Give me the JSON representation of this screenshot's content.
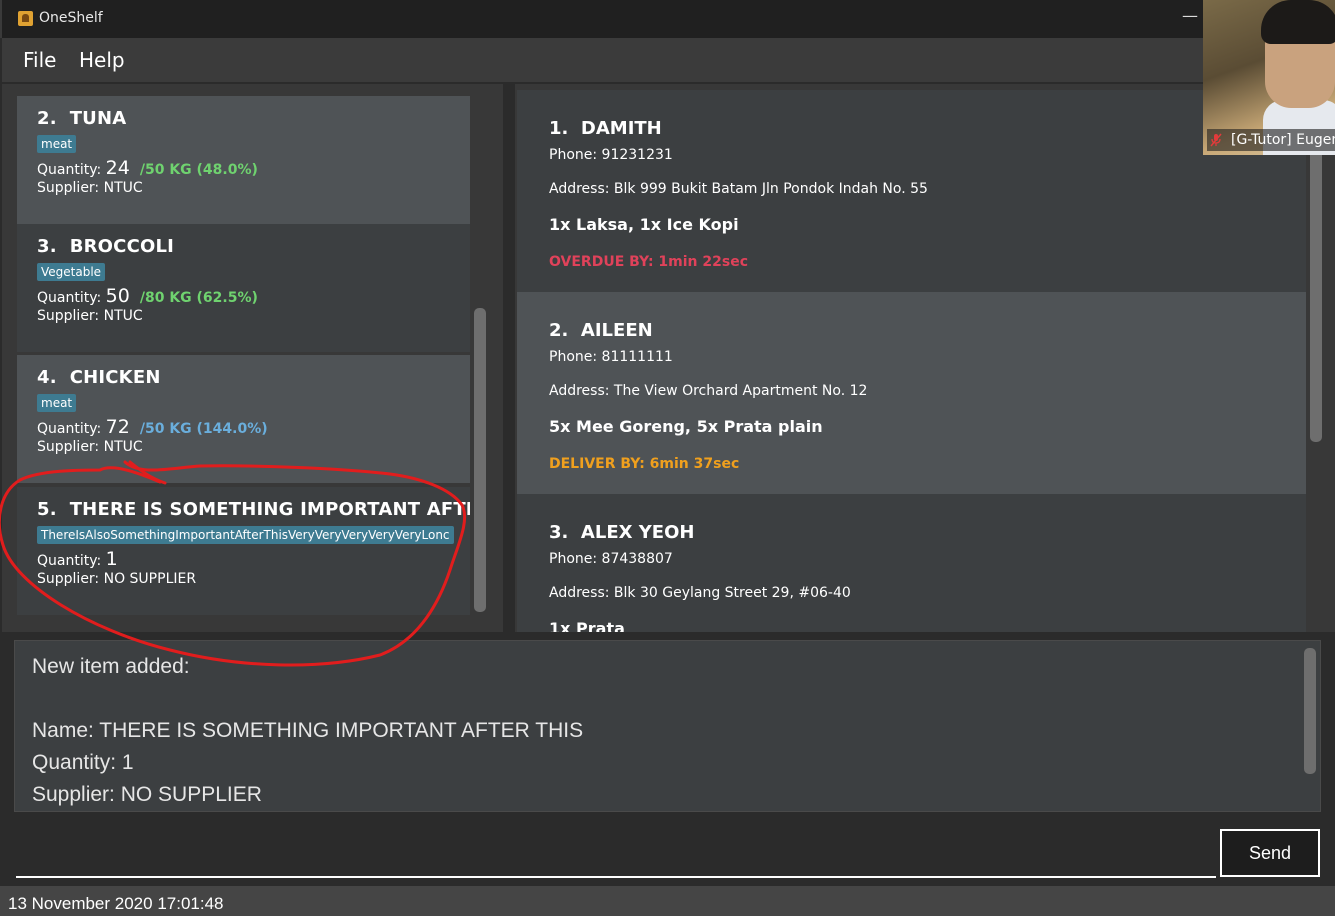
{
  "window": {
    "title": "OneShelf",
    "minimize_glyph": "—"
  },
  "menu": {
    "items": [
      {
        "label": "File"
      },
      {
        "label": "Help"
      }
    ]
  },
  "inventory": {
    "items": [
      {
        "index": "2.",
        "name": "TUNA",
        "tag": "meat",
        "quantity_label": "Quantity:",
        "quantity": "24",
        "max_label": "/50 KG (48.0%)",
        "max_color": "#6fd26f",
        "supplier": "Supplier: NTUC"
      },
      {
        "index": "3.",
        "name": "BROCCOLI",
        "tag": "Vegetable",
        "quantity_label": "Quantity:",
        "quantity": "50",
        "max_label": "/80 KG (62.5%)",
        "max_color": "#6fd26f",
        "supplier": "Supplier: NTUC"
      },
      {
        "index": "4.",
        "name": "CHICKEN",
        "tag": "meat",
        "quantity_label": "Quantity:",
        "quantity": "72",
        "max_label": "/50 KG (144.0%)",
        "max_color": "#6aaedc",
        "supplier": "Supplier: NTUC"
      },
      {
        "index": "5.",
        "name": "THERE IS SOMETHING IMPORTANT AFTER TI",
        "tag": "ThereIsAlsoSomethingImportantAfterThisVeryVeryVeryVeryVeryLonc",
        "quantity_label": "Quantity:",
        "quantity": "1",
        "max_label": "",
        "max_color": "#6fd26f",
        "supplier": "Supplier: NO SUPPLIER"
      }
    ]
  },
  "orders": {
    "items": [
      {
        "index": "1.",
        "name": "DAMITH",
        "phone": "Phone: 91231231",
        "address": "Address: Blk 999 Bukit Batam Jln Pondok Indah No. 55",
        "items": "1x Laksa, 1x Ice Kopi",
        "due": "OVERDUE BY: 1min 22sec",
        "due_color": "#e0425a"
      },
      {
        "index": "2.",
        "name": "AILEEN",
        "phone": "Phone: 81111111",
        "address": "Address: The View Orchard Apartment No. 12",
        "items": "5x Mee Goreng, 5x Prata plain",
        "due": "DELIVER BY: 6min 37sec",
        "due_color": "#f0a01e"
      },
      {
        "index": "3.",
        "name": "ALEX YEOH",
        "phone": "Phone: 87438807",
        "address": "Address: Blk 30 Geylang Street 29, #06-40",
        "items": "1x Prata",
        "due": "",
        "due_color": "#f0a01e"
      }
    ]
  },
  "video": {
    "participant": "[G-Tutor] Eugen",
    "mic_icon": "mic-muted-icon"
  },
  "result": {
    "lines": [
      "New item added:",
      "",
      "Name: THERE IS SOMETHING IMPORTANT AFTER THIS",
      "Quantity: 1",
      "Supplier: NO SUPPLIER"
    ]
  },
  "command": {
    "value": "",
    "send_label": "Send"
  },
  "status": {
    "timestamp": "13 November 2020 17:01:48"
  },
  "colors": {
    "accent_tag": "#3e7b91",
    "annotation": "#e11d1d"
  }
}
